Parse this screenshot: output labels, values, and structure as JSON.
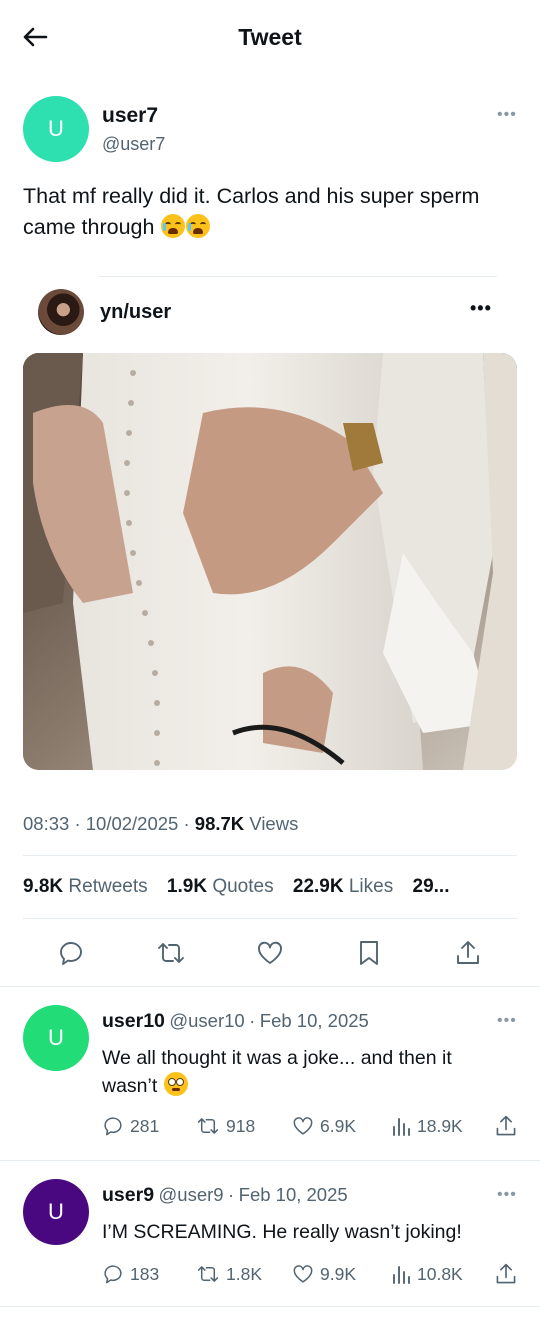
{
  "header": {
    "title": "Tweet"
  },
  "main_tweet": {
    "avatar_letter": "U",
    "avatar_color": "#2ee0b0",
    "name": "user7",
    "handle": "@user7",
    "text": "That mf really did it. Carlos and his super sperm came through",
    "emojis": [
      "loudly-crying-face",
      "loudly-crying-face"
    ],
    "embed": {
      "name": "yn/user",
      "media": "photo-pregnant-belly-hands"
    },
    "time": "08:33",
    "date": "10/02/2025",
    "views": "98.7K",
    "views_label": "Views",
    "stats": [
      {
        "value": "9.8K",
        "label": "Retweets"
      },
      {
        "value": "1.9K",
        "label": "Quotes"
      },
      {
        "value": "22.9K",
        "label": "Likes"
      },
      {
        "value": "29...",
        "label": ""
      }
    ],
    "actions": [
      "reply-icon",
      "retweet-icon",
      "like-icon",
      "bookmark-icon",
      "share-icon"
    ]
  },
  "replies": [
    {
      "avatar_letter": "U",
      "avatar_color": "#22dd77",
      "name": "user10",
      "handle": "@user10",
      "date": "Feb 10, 2025",
      "text": "We all thought it was a joke... and then it wasn’t",
      "emoji": "flushed-face",
      "replies": "281",
      "retweets": "918",
      "likes": "6.9K",
      "views": "18.9K"
    },
    {
      "avatar_letter": "U",
      "avatar_color": "#4a0880",
      "name": "user9",
      "handle": "@user9",
      "date": "Feb 10, 2025",
      "text": "I’M SCREAMING. He really wasn’t joking!",
      "replies": "183",
      "retweets": "1.8K",
      "likes": "9.9K",
      "views": "10.8K"
    }
  ],
  "colors": {
    "text": "#0f1419",
    "muted": "#536471",
    "divider": "#e6ecf0"
  }
}
